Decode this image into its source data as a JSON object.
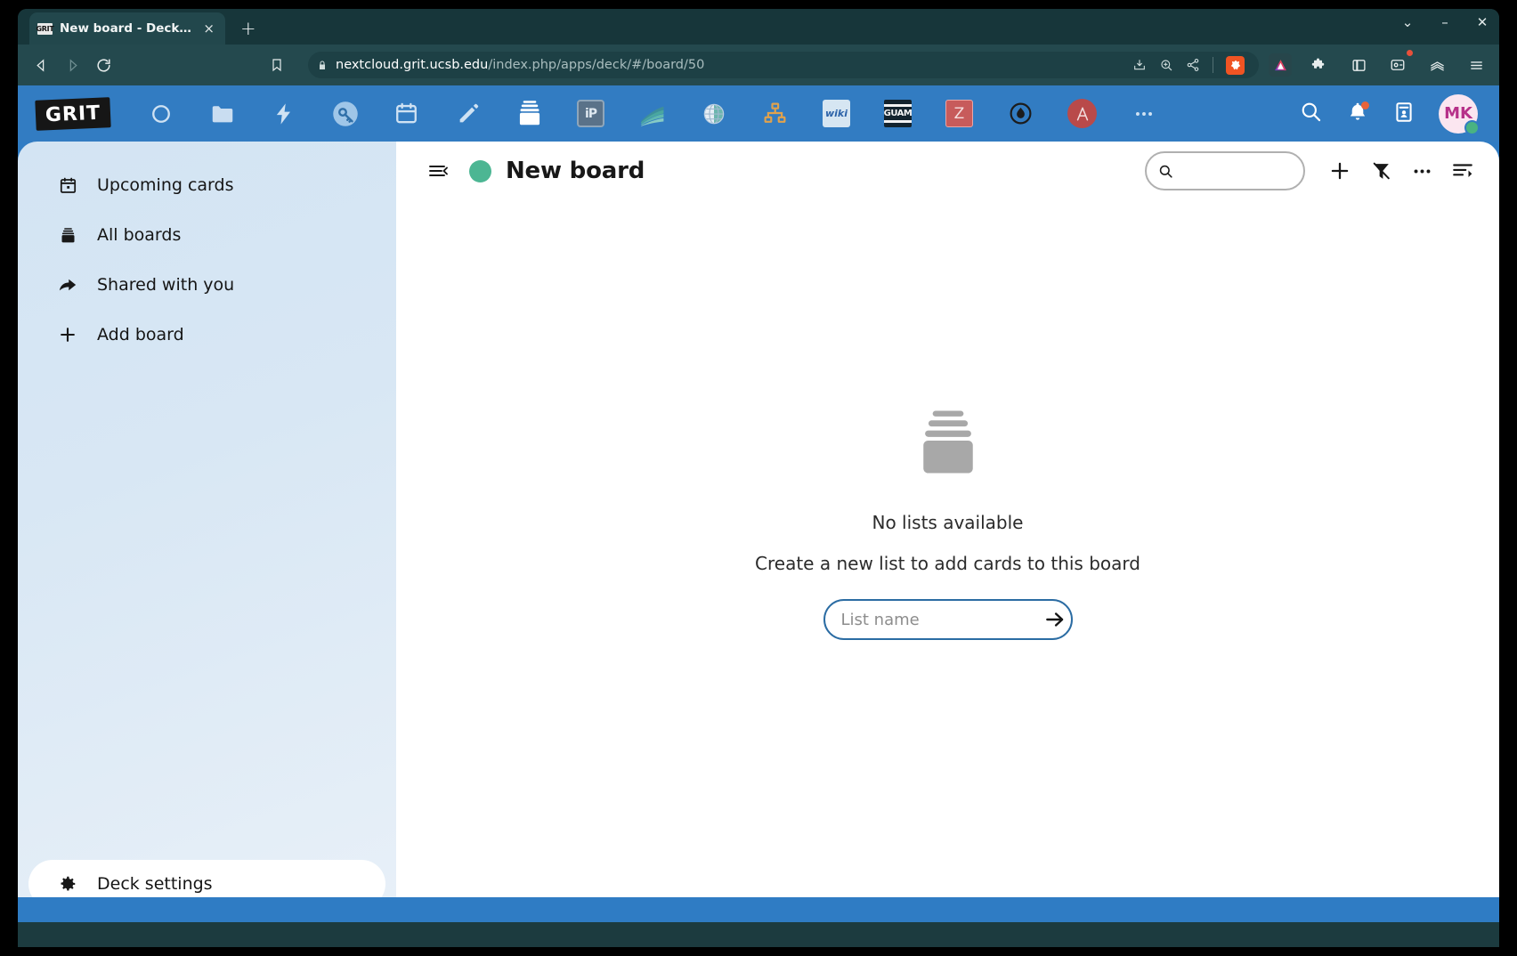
{
  "browser": {
    "tab": {
      "favicon_text": "GRIT",
      "title": "New board - Deck - Nextcloud",
      "close_label": "×"
    },
    "new_tab_label": "+",
    "window_controls": {
      "minimize_extra": "⌄",
      "minimize": "–",
      "close": "✕"
    },
    "url": {
      "host": "nextcloud.grit.ucsb.edu",
      "path": "/index.php/apps/deck/#/board/50",
      "lock_icon": "lock-icon"
    },
    "icons": {
      "back": "back-arrow-icon",
      "forward": "forward-arrow-icon",
      "reload": "reload-icon",
      "bookmark": "bookmark-icon",
      "install": "install-app-icon",
      "zoom": "zoom-icon",
      "share": "share-icon",
      "brave_shields": "brave-lion-icon",
      "brave_rewards": "brave-triangle-icon",
      "extensions": "puzzle-extensions-icon",
      "sidepanel": "side-panel-icon",
      "profile": "profile-icon",
      "brave_leo": "brave-leo-icon",
      "menu": "hamburger-menu-icon"
    }
  },
  "nextcloud": {
    "logo_text": "GRIT",
    "apps": [
      {
        "name": "dashboard",
        "icon": "circle-dashboard-icon",
        "label": "Dashboard",
        "active": false
      },
      {
        "name": "files",
        "icon": "folder-icon",
        "label": "Files",
        "active": false
      },
      {
        "name": "activity",
        "icon": "lightning-bolt-icon",
        "label": "Activity",
        "active": false
      },
      {
        "name": "passwords",
        "icon": "key-circle-icon",
        "label": "Passwords",
        "active": false
      },
      {
        "name": "calendar",
        "icon": "calendar-icon",
        "label": "Calendar",
        "active": false
      },
      {
        "name": "notes",
        "icon": "pencil-icon",
        "label": "Notes",
        "active": false
      },
      {
        "name": "deck",
        "icon": "deck-stack-icon",
        "label": "Deck",
        "active": true
      },
      {
        "name": "ip-app",
        "icon": "ip-square-icon",
        "label": "iP",
        "active": false
      },
      {
        "name": "layers-app",
        "icon": "layers-icon",
        "label": "Layers",
        "active": false
      },
      {
        "name": "globe-app",
        "icon": "globe-icon",
        "label": "Globe",
        "active": false
      },
      {
        "name": "orgchart-app",
        "icon": "org-chart-icon",
        "label": "Org chart",
        "active": false
      },
      {
        "name": "wiki-app",
        "icon": "wiki-icon",
        "label": "wiki",
        "active": false
      },
      {
        "name": "guam-app",
        "icon": "guam-icon",
        "label": "GUAM",
        "active": false
      },
      {
        "name": "z-app",
        "icon": "z-letter-icon",
        "label": "Z",
        "active": false
      },
      {
        "name": "flame-app",
        "icon": "flame-circle-icon",
        "label": "Flame",
        "active": false
      },
      {
        "name": "a-app",
        "icon": "a-circle-icon",
        "label": "A",
        "active": false
      },
      {
        "name": "more-apps",
        "icon": "ellipsis-icon",
        "label": "…",
        "active": false
      }
    ],
    "header_right": {
      "search": "search-icon",
      "notifications": "bell-icon",
      "contacts": "contacts-icon",
      "avatar_initials": "MK",
      "avatar_status": "online"
    }
  },
  "sidebar": {
    "items": [
      {
        "label": "Upcoming cards",
        "icon": "calendar-icon"
      },
      {
        "label": "All boards",
        "icon": "archive-boards-icon"
      },
      {
        "label": "Shared with you",
        "icon": "share-arrow-icon"
      },
      {
        "label": "Add board",
        "icon": "plus-icon"
      }
    ],
    "settings_label": "Deck settings",
    "settings_icon": "gear-icon"
  },
  "board": {
    "title": "New board",
    "color": "#4cb693",
    "collapse_icon": "collapse-sidebar-icon",
    "toolbar": {
      "search_placeholder": "",
      "search_icon": "search-icon",
      "add_icon": "plus-icon",
      "filter_icon": "filter-off-icon",
      "more_icon": "ellipsis-icon",
      "details_icon": "board-details-icon"
    },
    "empty_state": {
      "icon": "deck-stack-icon",
      "title": "No lists available",
      "subtitle": "Create a new list to add cards to this board",
      "input_placeholder": "List name",
      "input_value": "",
      "submit_icon": "arrow-right-icon"
    }
  },
  "colors": {
    "nextcloud_blue": "#327cc2",
    "board_green": "#4cb693",
    "browser_dark": "#1c3b3f",
    "sidebar_blue": "#d8e7f4"
  }
}
